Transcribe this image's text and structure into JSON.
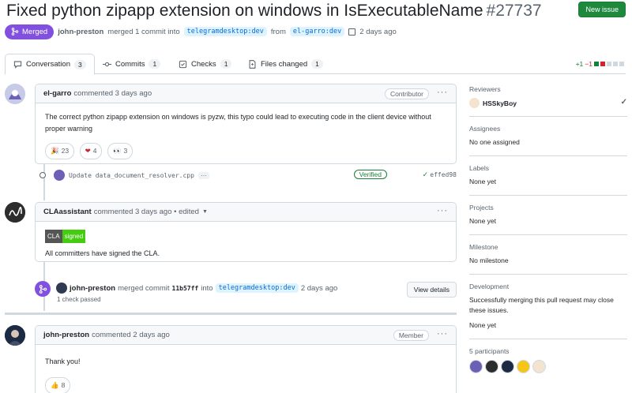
{
  "header": {
    "title": "Fixed python zipapp extension on windows in IsExecutableName",
    "number": "#27737",
    "new_issue_label": "New issue"
  },
  "meta": {
    "state": "Merged",
    "author": "john-preston",
    "action": "merged 1 commit into",
    "target_branch": "telegramdesktop:dev",
    "from_word": "from",
    "source_branch": "el-garro:dev",
    "time": "2 days ago"
  },
  "tabs": [
    {
      "label": "Conversation",
      "count": "3"
    },
    {
      "label": "Commits",
      "count": "1"
    },
    {
      "label": "Checks",
      "count": "1"
    },
    {
      "label": "Files changed",
      "count": "1"
    }
  ],
  "diffstat": {
    "additions": "+1",
    "deletions": "−1"
  },
  "comments": [
    {
      "author": "el-garro",
      "meta": "commented 3 days ago",
      "role": "Contributor",
      "body": "The correct python zipapp extension on windows is pyzw, this typo could lead to executing code in the client device without proper warning",
      "reactions": [
        {
          "emoji": "🎉",
          "count": "23"
        },
        {
          "emoji": "❤",
          "count": "4"
        },
        {
          "emoji": "👀",
          "count": "3"
        }
      ]
    },
    {
      "author": "CLAassistant",
      "meta": "commented 3 days ago • edited",
      "cla_left": "CLA",
      "cla_right": "signed",
      "body": "All committers have signed the CLA."
    },
    {
      "author": "john-preston",
      "meta": "commented 2 days ago",
      "role": "Member",
      "body": "Thank you!",
      "reactions": [
        {
          "emoji": "👍",
          "count": "8"
        }
      ]
    }
  ],
  "commit": {
    "message": "Update data_document_resolver.cpp",
    "ellipsis": "···",
    "verified": "Verified",
    "sha": "effed98"
  },
  "merge_event": {
    "author": "john-preston",
    "action": "merged commit",
    "sha": "11b57ff",
    "into": "into",
    "branch": "telegramdesktop:dev",
    "time": "2 days ago",
    "checks": "1 check passed",
    "view_details": "View details"
  },
  "sidebar": {
    "reviewers_heading": "Reviewers",
    "reviewer": "HSSkyBoy",
    "assignees_heading": "Assignees",
    "assignees_value": "No one assigned",
    "labels_heading": "Labels",
    "labels_value": "None yet",
    "projects_heading": "Projects",
    "projects_value": "None yet",
    "milestone_heading": "Milestone",
    "milestone_value": "No milestone",
    "development_heading": "Development",
    "development_text": "Successfully merging this pull request may close these issues.",
    "development_value": "None yet",
    "participants_heading": "5 participants"
  },
  "colors": {
    "merged": "#8250df",
    "primary_button": "#1f883d",
    "link": "#0969da",
    "border": "#d1d9e0"
  }
}
